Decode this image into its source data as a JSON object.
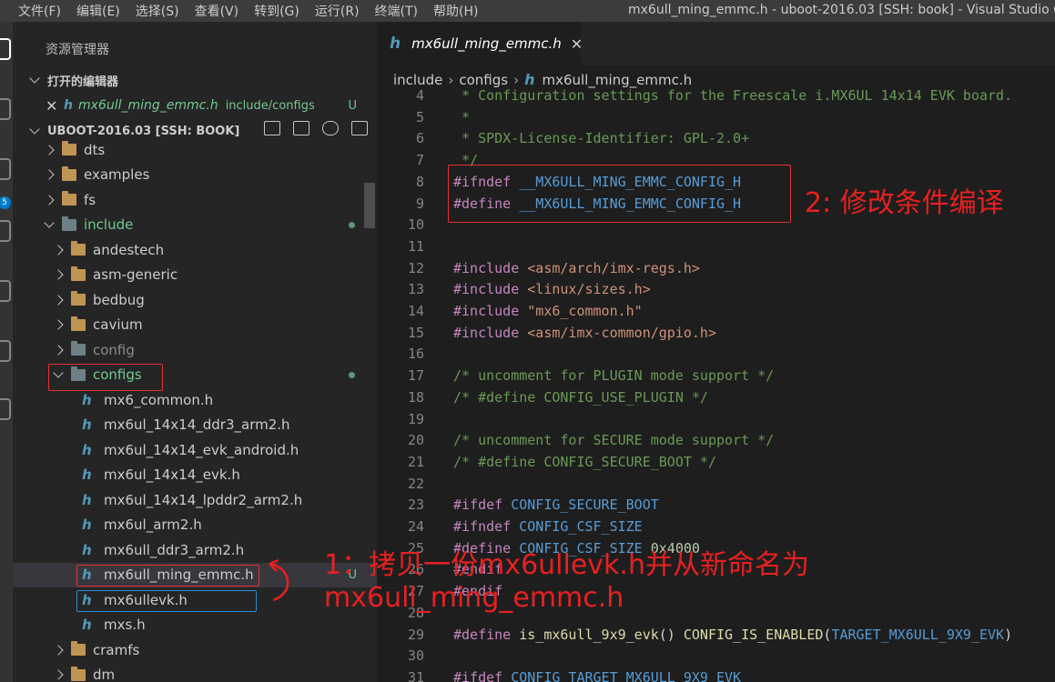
{
  "menu": [
    "文件(F)",
    "编辑(E)",
    "选择(S)",
    "查看(V)",
    "转到(G)",
    "运行(R)",
    "终端(T)",
    "帮助(H)"
  ],
  "window_title": "mx6ull_ming_emmc.h - uboot-2016.03 [SSH: book] - Visual Studio Code",
  "activity": {
    "badge": "5"
  },
  "sidebar": {
    "title": "资源管理器",
    "open_editors_label": "打开的编辑器",
    "open_editor": {
      "name": "mx6ull_ming_emmc.h",
      "path": "include/configs",
      "status": "U"
    },
    "workspace_label": "UBOOT-2016.03 [SSH: BOOK]",
    "tree": [
      {
        "name": "dts",
        "kind": "folder",
        "indent": 1,
        "state": "right"
      },
      {
        "name": "examples",
        "kind": "folder",
        "indent": 1,
        "state": "right"
      },
      {
        "name": "fs",
        "kind": "folder",
        "indent": 1,
        "state": "right"
      },
      {
        "name": "include",
        "kind": "special-folder",
        "indent": 1,
        "state": "down",
        "color": "green",
        "dot": true
      },
      {
        "name": "andestech",
        "kind": "folder",
        "indent": 2,
        "state": "right"
      },
      {
        "name": "asm-generic",
        "kind": "folder",
        "indent": 2,
        "state": "right"
      },
      {
        "name": "bedbug",
        "kind": "folder",
        "indent": 2,
        "state": "right"
      },
      {
        "name": "cavium",
        "kind": "folder",
        "indent": 2,
        "state": "right"
      },
      {
        "name": "config",
        "kind": "special-folder",
        "indent": 2,
        "state": "right",
        "color": "dim"
      },
      {
        "name": "configs",
        "kind": "special-folder",
        "indent": 2,
        "state": "down",
        "color": "green",
        "dot": true
      },
      {
        "name": "mx6_common.h",
        "kind": "file",
        "indent": 3
      },
      {
        "name": "mx6ul_14x14_ddr3_arm2.h",
        "kind": "file",
        "indent": 3
      },
      {
        "name": "mx6ul_14x14_evk_android.h",
        "kind": "file",
        "indent": 3
      },
      {
        "name": "mx6ul_14x14_evk.h",
        "kind": "file",
        "indent": 3
      },
      {
        "name": "mx6ul_14x14_lpddr2_arm2.h",
        "kind": "file",
        "indent": 3
      },
      {
        "name": "mx6ul_arm2.h",
        "kind": "file",
        "indent": 3
      },
      {
        "name": "mx6ull_ddr3_arm2.h",
        "kind": "file",
        "indent": 3
      },
      {
        "name": "mx6ull_ming_emmc.h",
        "kind": "file",
        "indent": 3,
        "selected": true,
        "status": "U"
      },
      {
        "name": "mx6ullevk.h",
        "kind": "file",
        "indent": 3
      },
      {
        "name": "mxs.h",
        "kind": "file",
        "indent": 3
      },
      {
        "name": "cramfs",
        "kind": "folder",
        "indent": 2,
        "state": "right"
      },
      {
        "name": "dm",
        "kind": "folder",
        "indent": 2,
        "state": "right"
      }
    ]
  },
  "editor": {
    "tab": {
      "name": "mx6ull_ming_emmc.h",
      "close": "✕"
    },
    "breadcrumb": [
      "include",
      "configs",
      "mx6ull_ming_emmc.h"
    ],
    "lines": [
      {
        "n": "4",
        "parts": [
          [
            "c-comment",
            " * Configuration settings for the Freescale i.MX6UL 14x14 EVK board."
          ]
        ]
      },
      {
        "n": "5",
        "parts": [
          [
            "c-comment",
            " *"
          ]
        ]
      },
      {
        "n": "6",
        "parts": [
          [
            "c-comment",
            " * SPDX-License-Identifier: GPL-2.0+"
          ]
        ]
      },
      {
        "n": "7",
        "parts": [
          [
            "c-comment",
            " */"
          ]
        ]
      },
      {
        "n": "8",
        "parts": [
          [
            "c-kw",
            "#ifndef"
          ],
          [
            "c-plain",
            " "
          ],
          [
            "c-macro",
            "__MX6ULL_MING_EMMC_CONFIG_H"
          ]
        ]
      },
      {
        "n": "9",
        "parts": [
          [
            "c-kw",
            "#define"
          ],
          [
            "c-plain",
            " "
          ],
          [
            "c-macro",
            "__MX6ULL_MING_EMMC_CONFIG_H"
          ]
        ]
      },
      {
        "n": "10",
        "parts": []
      },
      {
        "n": "11",
        "parts": []
      },
      {
        "n": "12",
        "parts": [
          [
            "c-kw",
            "#include"
          ],
          [
            "c-plain",
            " "
          ],
          [
            "c-str",
            "<asm/arch/imx-regs.h>"
          ]
        ]
      },
      {
        "n": "13",
        "parts": [
          [
            "c-kw",
            "#include"
          ],
          [
            "c-plain",
            " "
          ],
          [
            "c-str",
            "<linux/sizes.h>"
          ]
        ]
      },
      {
        "n": "14",
        "parts": [
          [
            "c-kw",
            "#include"
          ],
          [
            "c-plain",
            " "
          ],
          [
            "c-str",
            "\"mx6_common.h\""
          ]
        ]
      },
      {
        "n": "15",
        "parts": [
          [
            "c-kw",
            "#include"
          ],
          [
            "c-plain",
            " "
          ],
          [
            "c-str",
            "<asm/imx-common/gpio.h>"
          ]
        ]
      },
      {
        "n": "16",
        "parts": []
      },
      {
        "n": "17",
        "parts": [
          [
            "c-comment",
            "/* uncomment for PLUGIN mode support */"
          ]
        ]
      },
      {
        "n": "18",
        "parts": [
          [
            "c-comment",
            "/* #define CONFIG_USE_PLUGIN */"
          ]
        ]
      },
      {
        "n": "19",
        "parts": []
      },
      {
        "n": "20",
        "parts": [
          [
            "c-comment",
            "/* uncomment for SECURE mode support */"
          ]
        ]
      },
      {
        "n": "21",
        "parts": [
          [
            "c-comment",
            "/* #define CONFIG_SECURE_BOOT */"
          ]
        ]
      },
      {
        "n": "22",
        "parts": []
      },
      {
        "n": "23",
        "parts": [
          [
            "c-kw",
            "#ifdef"
          ],
          [
            "c-plain",
            " "
          ],
          [
            "c-macro",
            "CONFIG_SECURE_BOOT"
          ]
        ]
      },
      {
        "n": "24",
        "parts": [
          [
            "c-kw",
            "#ifndef"
          ],
          [
            "c-plain",
            " "
          ],
          [
            "c-macro",
            "CONFIG_CSF_SIZE"
          ]
        ]
      },
      {
        "n": "25",
        "parts": [
          [
            "c-kw",
            "#define"
          ],
          [
            "c-plain",
            " "
          ],
          [
            "c-macro",
            "CONFIG_CSF_SIZE"
          ],
          [
            "c-plain",
            " "
          ],
          [
            "c-num",
            "0x4000"
          ]
        ]
      },
      {
        "n": "26",
        "parts": [
          [
            "c-kw",
            "#endif"
          ]
        ]
      },
      {
        "n": "27",
        "parts": [
          [
            "c-kw",
            "#endif"
          ]
        ]
      },
      {
        "n": "28",
        "parts": []
      },
      {
        "n": "29",
        "parts": [
          [
            "c-kw",
            "#define"
          ],
          [
            "c-plain",
            " "
          ],
          [
            "c-fn",
            "is_mx6ull_9x9_evk"
          ],
          [
            "c-plain",
            "() "
          ],
          [
            "c-fn",
            "CONFIG_IS_ENABLED"
          ],
          [
            "c-plain",
            "("
          ],
          [
            "c-macro",
            "TARGET_MX6ULL_9X9_EVK"
          ],
          [
            "c-plain",
            ")"
          ]
        ]
      },
      {
        "n": "30",
        "parts": []
      },
      {
        "n": "31",
        "parts": [
          [
            "c-kw",
            "#ifdef"
          ],
          [
            "c-plain",
            " "
          ],
          [
            "c-macro",
            "CONFIG_TARGET_MX6ULL_9X9_EVK"
          ]
        ]
      }
    ]
  },
  "annotations": {
    "step2": "2: 修改条件编译",
    "step1_line1": "1：拷贝一份mx6ullevk.h并从新命名为",
    "step1_line2": "mx6ull_ming_emmc.h"
  }
}
